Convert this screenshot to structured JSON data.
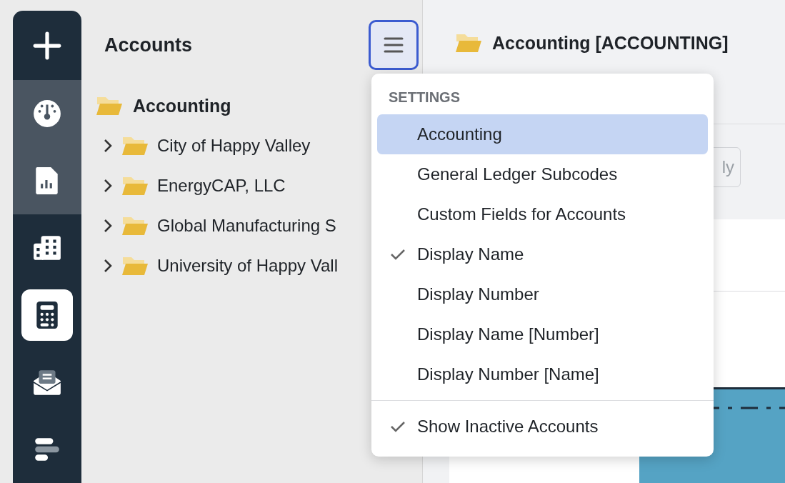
{
  "nav": {
    "items": [
      {
        "selected": false,
        "highlighted": false
      },
      {
        "selected": false,
        "highlighted": true
      },
      {
        "selected": false,
        "highlighted": true
      },
      {
        "selected": false,
        "highlighted": false
      },
      {
        "selected": true,
        "highlighted": false
      },
      {
        "selected": false,
        "highlighted": false
      },
      {
        "selected": false,
        "highlighted": false
      }
    ]
  },
  "sidebar": {
    "title": "Accounts",
    "tree": {
      "label": "Accounting",
      "children": [
        {
          "label": "City of Happy Valley",
          "expanded": false
        },
        {
          "label": "EnergyCAP, LLC",
          "expanded": false
        },
        {
          "label": "Global Manufacturing S",
          "expanded": false
        },
        {
          "label": "University of Happy Vall",
          "expanded": false
        }
      ]
    }
  },
  "main": {
    "title": "Accounting [ACCOUNTING]",
    "toolbar_button": "ly"
  },
  "menu": {
    "header": "SETTINGS",
    "sections": [
      {
        "items": [
          {
            "label": "Accounting",
            "selected": true,
            "checked": false
          },
          {
            "label": "General Ledger Subcodes",
            "selected": false,
            "checked": false
          },
          {
            "label": "Custom Fields for Accounts",
            "selected": false,
            "checked": false
          },
          {
            "label": "Display Name",
            "selected": false,
            "checked": true
          },
          {
            "label": "Display Number",
            "selected": false,
            "checked": false
          },
          {
            "label": "Display Name [Number]",
            "selected": false,
            "checked": false
          },
          {
            "label": "Display Number [Name]",
            "selected": false,
            "checked": false
          }
        ]
      },
      {
        "items": [
          {
            "label": "Show Inactive Accounts",
            "selected": false,
            "checked": true
          }
        ]
      }
    ]
  }
}
